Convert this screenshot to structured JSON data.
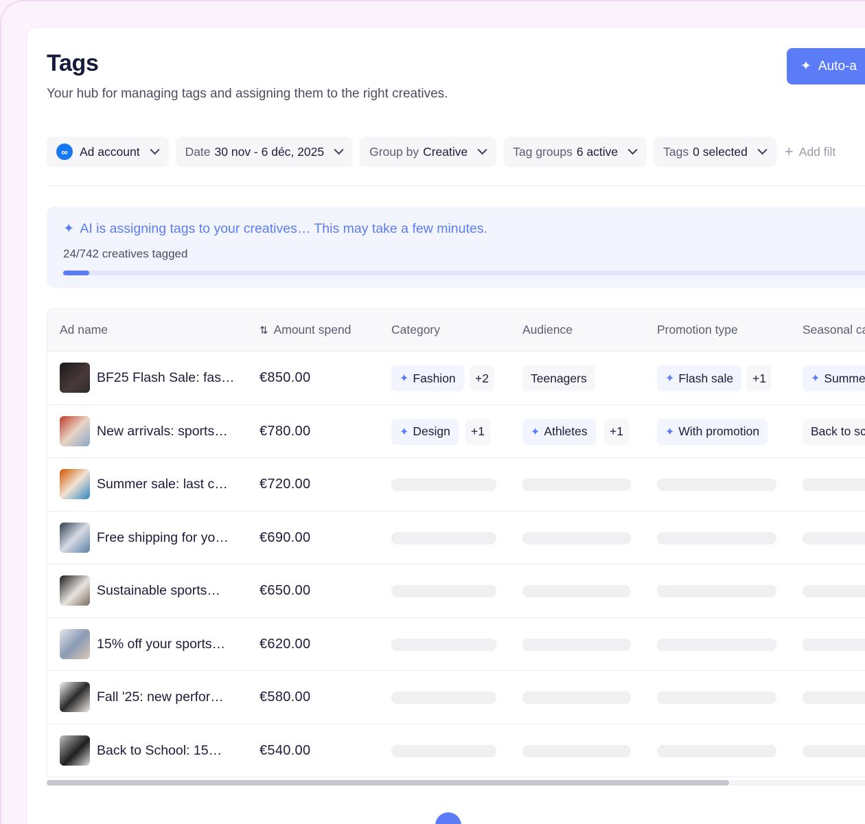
{
  "header": {
    "title": "Tags",
    "subtitle": "Your hub for managing tags and assigning them to the right creatives.",
    "auto_button_label": "Auto-a"
  },
  "filters": {
    "ad_account": "Ad account",
    "date_label": "Date",
    "date_value": "30 nov - 6 déc, 2025",
    "group_label": "Group by",
    "group_value": "Creative",
    "tag_groups_label": "Tag groups",
    "tag_groups_value": "6 active",
    "tags_label": "Tags",
    "tags_value": "0 selected",
    "add_filter": "Add filt"
  },
  "ai_status": {
    "message": "AI is assigning tags to your creatives… This may take a few minutes.",
    "count": "24/742 creatives tagged",
    "progress": 0.032
  },
  "table": {
    "columns": [
      "Ad name",
      "Amount spend",
      "Category",
      "Audience",
      "Promotion type",
      "Seasonal ca"
    ],
    "rows": [
      {
        "name": "BF25 Flash Sale: fas…",
        "amount": "€850.00",
        "category": "Fashion",
        "category_more": "+2",
        "audience": "Teenagers",
        "promotion": "Flash sale",
        "promotion_more": "+1",
        "seasonal": "Summe"
      },
      {
        "name": "New arrivals: sports…",
        "amount": "€780.00",
        "category": "Design",
        "category_more": "+1",
        "audience": "Athletes",
        "audience_more": "+1",
        "promotion": "With promotion",
        "seasonal": "Back to sc"
      },
      {
        "name": "Summer sale: last c…",
        "amount": "€720.00"
      },
      {
        "name": "Free shipping for yo…",
        "amount": "€690.00"
      },
      {
        "name": "Sustainable sports…",
        "amount": "€650.00"
      },
      {
        "name": "15% off your sports…",
        "amount": "€620.00"
      },
      {
        "name": "Fall '25: new perfor…",
        "amount": "€580.00"
      },
      {
        "name": "Back to School: 15…",
        "amount": "€540.00"
      }
    ]
  },
  "colors": {
    "accent": "#5b7cf6",
    "meta_blue": "#1877f2"
  }
}
